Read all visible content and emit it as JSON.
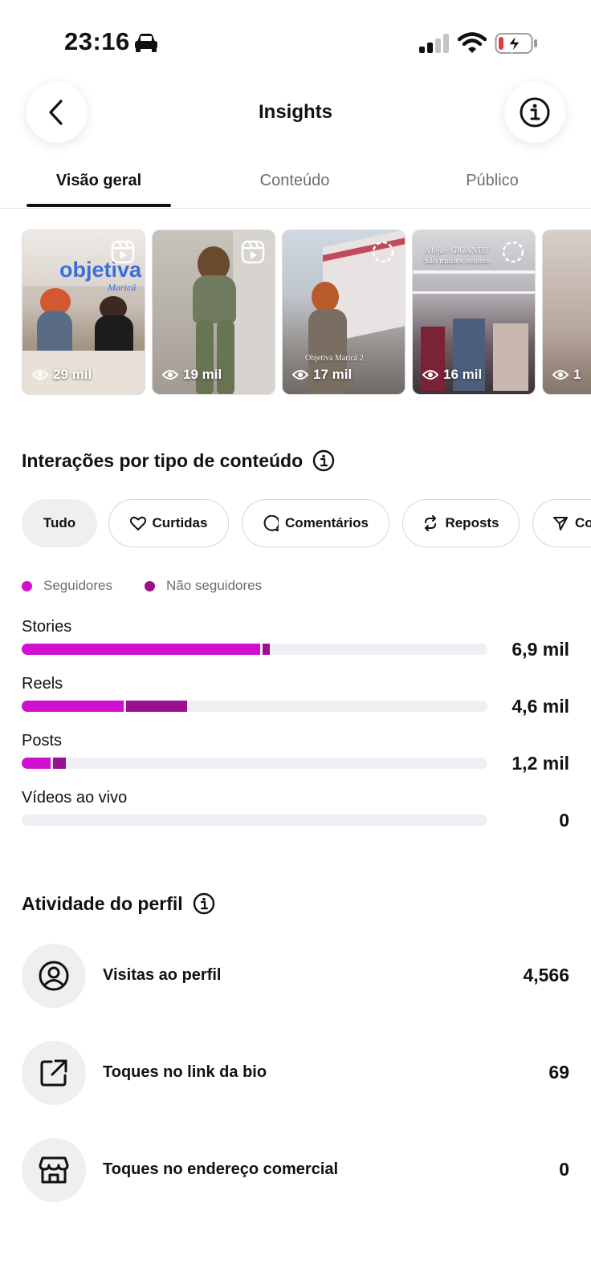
{
  "status_bar": {
    "time": "23:16",
    "icons": [
      "car-icon",
      "signal-icon",
      "wifi-icon",
      "battery-charging-icon"
    ],
    "battery_color": "#e23b3b"
  },
  "header": {
    "title": "Insights",
    "back_icon": "chevron-left-icon",
    "info_icon": "info-icon"
  },
  "tabs": [
    {
      "label": "Visão geral",
      "active": true
    },
    {
      "label": "Conteúdo",
      "active": false
    },
    {
      "label": "Público",
      "active": false
    }
  ],
  "thumbnails": [
    {
      "views": "29 mil",
      "badge": "reels-icon",
      "overlay_text": "objetiva",
      "overlay_subtext": "Maricá"
    },
    {
      "views": "19 mil",
      "badge": "reels-icon"
    },
    {
      "views": "17 mil",
      "badge": "story-ring-icon",
      "overlay_text": "Objetiva Maricá 2"
    },
    {
      "views": "16 mil",
      "badge": "story-ring-icon",
      "overlay_text": "A loja é GIGANTE!",
      "overlay_subtext": "São muitos setores"
    },
    {
      "views": "1",
      "badge": ""
    }
  ],
  "interactions": {
    "title": "Interações por tipo de conteúdo",
    "filters": [
      {
        "label": "Tudo",
        "icon": "",
        "selected": true
      },
      {
        "label": "Curtidas",
        "icon": "heart-icon",
        "selected": false
      },
      {
        "label": "Comentários",
        "icon": "comment-icon",
        "selected": false
      },
      {
        "label": "Reposts",
        "icon": "repost-icon",
        "selected": false
      },
      {
        "label": "Co",
        "icon": "send-icon",
        "selected": false
      }
    ],
    "legend": [
      {
        "label": "Seguidores",
        "color": "#d10fd0"
      },
      {
        "label": "Não seguidores",
        "color": "#99118f"
      }
    ]
  },
  "chart_data": {
    "type": "bar",
    "orientation": "horizontal",
    "stacked": true,
    "categories": [
      "Stories",
      "Reels",
      "Posts",
      "Vídeos ao vivo"
    ],
    "value_labels": [
      "6,9 mil",
      "4,6 mil",
      "1,2 mil",
      "0"
    ],
    "series": [
      {
        "name": "Seguidores",
        "color": "#d10fd0",
        "values": [
          6700,
          2900,
          850,
          0
        ]
      },
      {
        "name": "Não seguidores",
        "color": "#99118f",
        "values": [
          200,
          1700,
          350,
          0
        ]
      }
    ],
    "max": 13000
  },
  "profile_activity": {
    "title": "Atividade do perfil",
    "rows": [
      {
        "label": "Visitas ao perfil",
        "value": "4,566",
        "icon": "user-circle-icon"
      },
      {
        "label": "Toques no link da bio",
        "value": "69",
        "icon": "external-link-icon"
      },
      {
        "label": "Toques no endereço comercial",
        "value": "0",
        "icon": "storefront-icon"
      }
    ]
  }
}
